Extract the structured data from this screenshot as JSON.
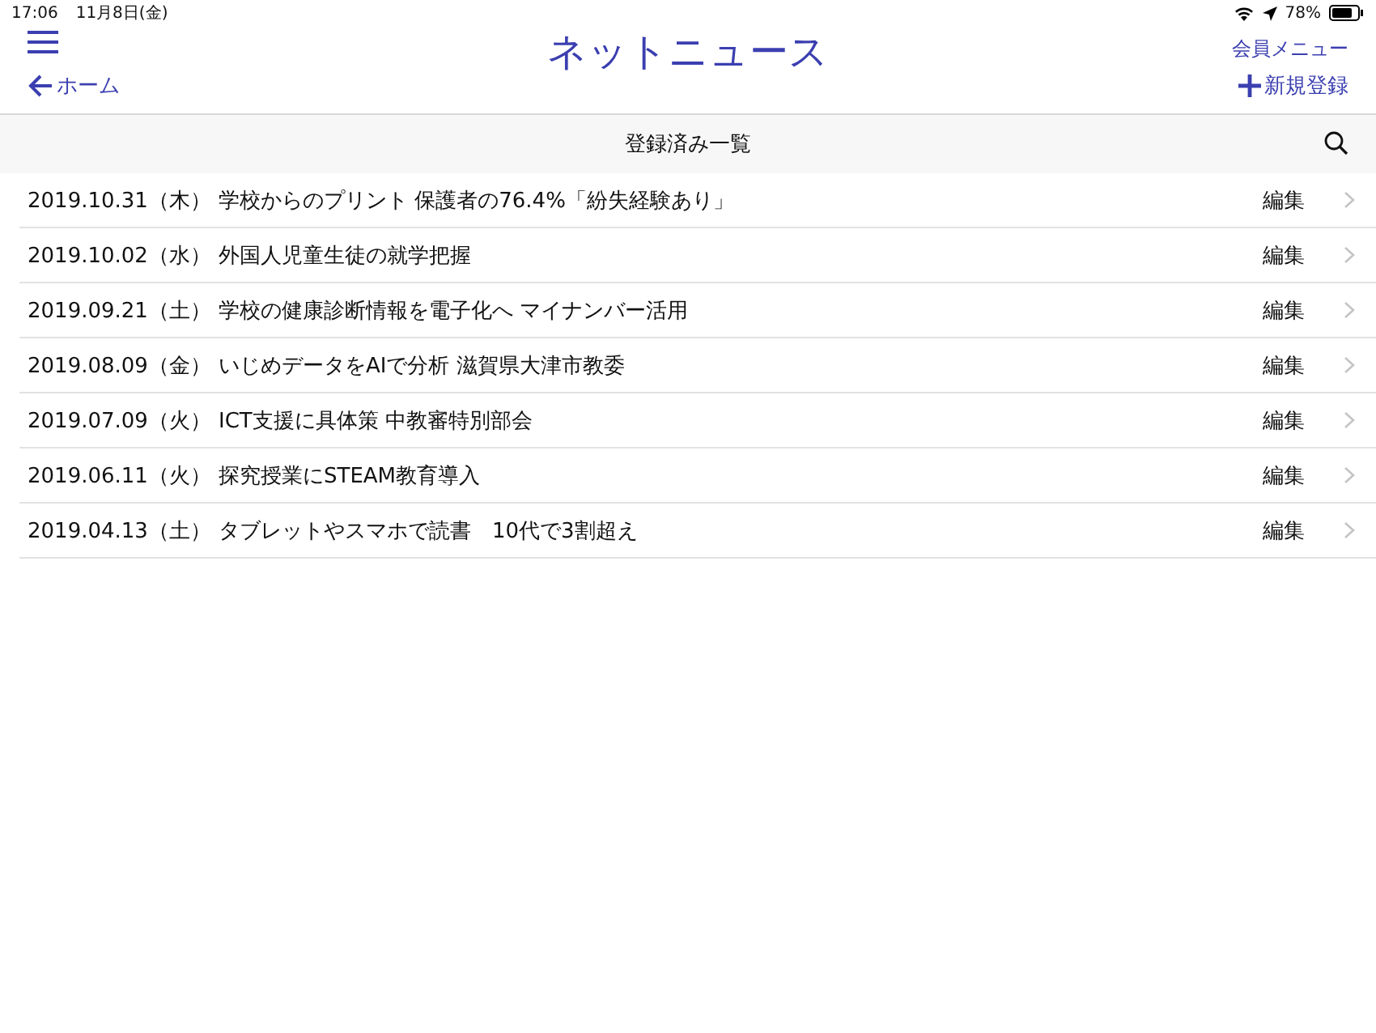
{
  "status_bar": {
    "time": "17:06",
    "date": "11月8日(金)",
    "battery": "78%"
  },
  "nav": {
    "title": "ネットニュース",
    "back": "ホーム",
    "member_menu": "会員メニュー",
    "add": "新規登録"
  },
  "section": {
    "title": "登録済み一覧"
  },
  "rows": [
    {
      "date": "2019.10.31（木）",
      "title": "学校からのプリント 保護者の76.4%「紛失経験あり」",
      "action": "編集"
    },
    {
      "date": "2019.10.02（水）",
      "title": "外国人児童生徒の就学把握",
      "action": "編集"
    },
    {
      "date": "2019.09.21（土）",
      "title": "学校の健康診断情報を電子化へ マイナンバー活用",
      "action": "編集"
    },
    {
      "date": "2019.08.09（金）",
      "title": "いじめデータをAIで分析 滋賀県大津市教委",
      "action": "編集"
    },
    {
      "date": "2019.07.09（火）",
      "title": "ICT支援に具体策 中教審特別部会",
      "action": "編集"
    },
    {
      "date": "2019.06.11（火）",
      "title": "探究授業にSTEAM教育導入",
      "action": "編集"
    },
    {
      "date": "2019.04.13（土）",
      "title": "タブレットやスマホで読書　10代で3割超え",
      "action": "編集"
    }
  ]
}
